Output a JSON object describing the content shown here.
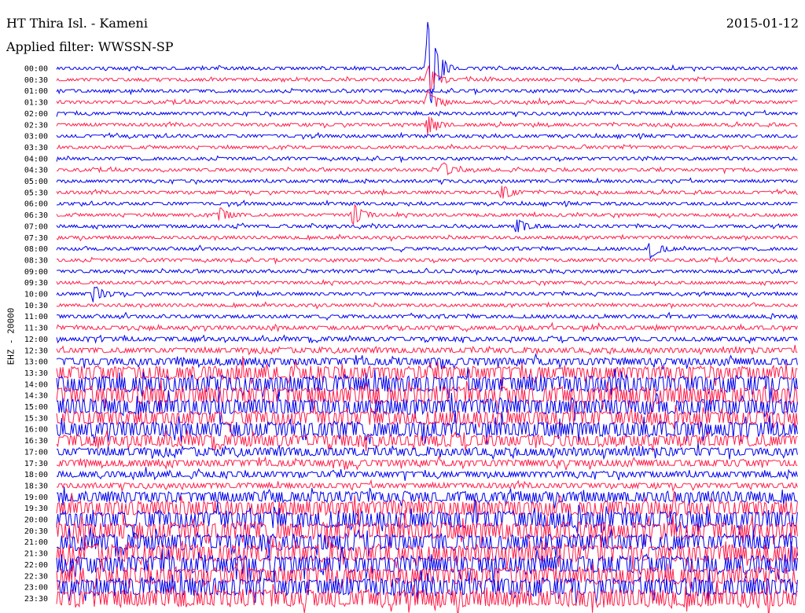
{
  "header": {
    "station": "HT Thira Isl. - Kameni",
    "date": "2015-01-12",
    "filter": "Applied filter: WWSSN-SP"
  },
  "chart_data": {
    "type": "line",
    "title": "HT Thira Isl. - Kameni",
    "subtitle": "Applied filter: WWSSN-SP",
    "date": "2015-01-12",
    "ylabel": "EHZ - 20000",
    "colors": [
      "#0000ee",
      "#ff1f4b"
    ],
    "time_labels": [
      "00:00",
      "00:30",
      "01:00",
      "01:30",
      "02:00",
      "02:30",
      "03:00",
      "03:30",
      "04:00",
      "04:30",
      "05:00",
      "05:30",
      "06:00",
      "06:30",
      "07:00",
      "07:30",
      "08:00",
      "08:30",
      "09:00",
      "09:30",
      "10:00",
      "10:30",
      "11:00",
      "11:30",
      "12:00",
      "12:30",
      "13:00",
      "13:30",
      "14:00",
      "14:30",
      "15:00",
      "15:30",
      "16:00",
      "16:30",
      "17:00",
      "17:30",
      "18:00",
      "18:30",
      "19:00",
      "19:30",
      "20:00",
      "20:30",
      "21:00",
      "21:30",
      "22:00",
      "22:30",
      "23:00",
      "23:30"
    ],
    "noise_level": [
      0.35,
      0.35,
      0.35,
      0.35,
      0.35,
      0.35,
      0.35,
      0.35,
      0.35,
      0.35,
      0.35,
      0.35,
      0.35,
      0.35,
      0.35,
      0.35,
      0.35,
      0.35,
      0.35,
      0.35,
      0.35,
      0.35,
      0.4,
      0.45,
      0.5,
      0.6,
      0.9,
      1.6,
      2.0,
      2.1,
      1.9,
      1.7,
      1.8,
      1.4,
      1.0,
      0.8,
      0.7,
      0.6,
      1.3,
      1.8,
      2.1,
      2.1,
      2.0,
      2.1,
      2.2,
      2.1,
      2.2,
      2.1
    ],
    "events": [
      {
        "trace": 0,
        "time_frac": 0.5,
        "amplitude": 18
      },
      {
        "trace": 1,
        "time_frac": 0.5,
        "amplitude": 5
      },
      {
        "trace": 3,
        "time_frac": 0.5,
        "amplitude": 4
      },
      {
        "trace": 5,
        "time_frac": 0.5,
        "amplitude": 3
      },
      {
        "trace": 9,
        "time_frac": 0.52,
        "amplitude": 2.5
      },
      {
        "trace": 11,
        "time_frac": 0.6,
        "amplitude": 2.5
      },
      {
        "trace": 13,
        "time_frac": 0.4,
        "amplitude": 4
      },
      {
        "trace": 13,
        "time_frac": 0.22,
        "amplitude": 2.5
      },
      {
        "trace": 14,
        "time_frac": 0.62,
        "amplitude": 2.8
      },
      {
        "trace": 16,
        "time_frac": 0.8,
        "amplitude": 3.5
      },
      {
        "trace": 20,
        "time_frac": 0.05,
        "amplitude": 3
      }
    ]
  }
}
